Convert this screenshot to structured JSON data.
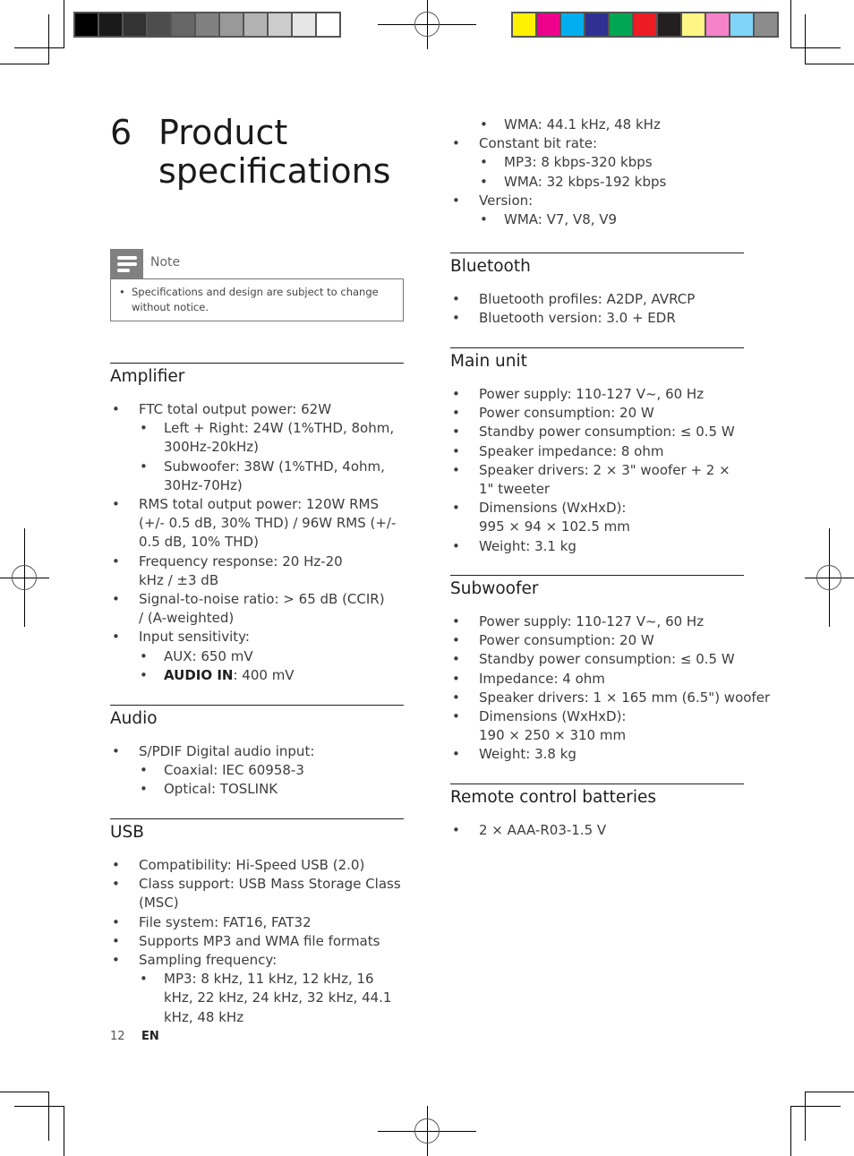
{
  "color_bars": {
    "grayscale": [
      "#000000",
      "#1a1a1a",
      "#333333",
      "#4d4d4d",
      "#666666",
      "#808080",
      "#999999",
      "#b3b3b3",
      "#cccccc",
      "#e6e6e6",
      "#ffffff"
    ],
    "process": [
      "#fff200",
      "#ec008c",
      "#00aeef",
      "#2e3192",
      "#00a651",
      "#ed1c24",
      "#231f20",
      "#fff685",
      "#f682c9",
      "#7fd5f7",
      "#8c8c8c"
    ]
  },
  "chapter": {
    "number": "6",
    "title": "Product specifications"
  },
  "note": {
    "label": "Note",
    "bullet": "•",
    "text": "Specifications and design are subject to change without notice."
  },
  "sections": {
    "amplifier": {
      "heading": "Amplifier",
      "items": [
        {
          "text": "FTC total output power: 62W"
        },
        {
          "text": "Left + Right: 24W (1%THD, 8ohm, 300Hz-20kHz)"
        },
        {
          "text": "Subwoofer: 38W (1%THD, 4ohm, 30Hz-70Hz)"
        },
        {
          "text": "RMS total output power: 120W RMS (+/- 0.5 dB, 30% THD) / 96W RMS (+/- 0.5 dB, 10% THD)"
        },
        {
          "text": "Frequency response: 20 Hz-20 kHz / ±3 dB"
        },
        {
          "text": "Signal-to-noise ratio: > 65 dB (CCIR) / (A-weighted)"
        },
        {
          "text": "Input sensitivity:"
        },
        {
          "text": "AUX: 650 mV"
        },
        {
          "bold": "AUDIO IN",
          "text": ": 400 mV"
        }
      ]
    },
    "audio": {
      "heading": "Audio",
      "items": [
        {
          "text": "S/PDIF Digital audio input:"
        },
        {
          "text": "Coaxial: IEC 60958-3"
        },
        {
          "text": "Optical: TOSLINK"
        }
      ]
    },
    "usb": {
      "heading": "USB",
      "items": [
        {
          "text": "Compatibility: Hi-Speed USB (2.0)"
        },
        {
          "text": "Class support: USB Mass Storage Class (MSC)"
        },
        {
          "text": "File system: FAT16, FAT32"
        },
        {
          "text": "Supports MP3 and WMA file formats"
        },
        {
          "text": "Sampling frequency:"
        },
        {
          "text": "MP3: 8 kHz, 11 kHz, 12 kHz, 16 kHz, 22 kHz, 24 kHz, 32 kHz, 44.1 kHz, 48 kHz"
        },
        {
          "text": "WMA: 44.1 kHz, 48 kHz"
        },
        {
          "text": "Constant bit rate:"
        },
        {
          "text": "MP3: 8 kbps-320 kbps"
        },
        {
          "text": "WMA: 32 kbps-192 kbps"
        },
        {
          "text": "Version:"
        },
        {
          "text": "WMA: V7, V8, V9"
        }
      ]
    },
    "bluetooth": {
      "heading": "Bluetooth",
      "items": [
        {
          "text": "Bluetooth profiles: A2DP, AVRCP"
        },
        {
          "text": "Bluetooth version: 3.0 + EDR"
        }
      ]
    },
    "main_unit": {
      "heading": "Main unit",
      "items": [
        {
          "text": "Power supply: 110-127 V~, 60 Hz"
        },
        {
          "text": "Power consumption: 20 W"
        },
        {
          "text": "Standby power consumption: ≤ 0.5 W"
        },
        {
          "text": "Speaker impedance: 8 ohm"
        },
        {
          "text": "Speaker drivers: 2 × 3\" woofer + 2 × 1\" tweeter"
        },
        {
          "text": "Dimensions (WxHxD): 995 × 94 × 102.5 mm"
        },
        {
          "text": "Weight: 3.1 kg"
        }
      ]
    },
    "subwoofer": {
      "heading": "Subwoofer",
      "items": [
        {
          "text": "Power supply: 110-127 V~, 60 Hz"
        },
        {
          "text": "Power consumption: 20 W"
        },
        {
          "text": "Standby power consumption: ≤ 0.5 W"
        },
        {
          "text": "Impedance: 4 ohm"
        },
        {
          "text": "Speaker drivers: 1 × 165 mm (6.5\") woofer"
        },
        {
          "text": "Dimensions (WxHxD): 190 × 250 × 310 mm"
        },
        {
          "text": "Weight: 3.8 kg"
        }
      ]
    },
    "remote": {
      "heading": "Remote control batteries",
      "items": [
        {
          "text": "2 × AAA-R03-1.5 V"
        }
      ]
    }
  },
  "bullet": "•",
  "footer": {
    "page_number": "12",
    "language": "EN"
  }
}
